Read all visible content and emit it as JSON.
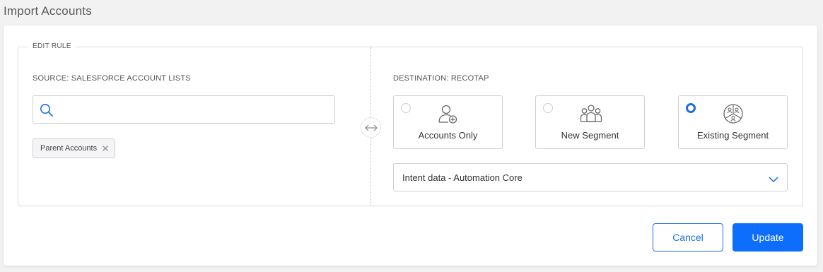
{
  "page": {
    "title": "Import Accounts"
  },
  "edit_rule": {
    "legend": "EDIT RULE",
    "source": {
      "label": "SOURCE: SALESFORCE ACCOUNT LISTS",
      "search": {
        "value": "",
        "placeholder": "",
        "icon": "search-icon"
      },
      "selected_chips": [
        {
          "label": "Parent Accounts"
        }
      ]
    },
    "swap_icon": "swap-arrows-icon",
    "destination": {
      "label": "DESTINATION: RECOTAP",
      "options": [
        {
          "label": "Accounts Only",
          "icon": "add-user-icon",
          "selected": false
        },
        {
          "label": "New Segment",
          "icon": "group-icon",
          "selected": false
        },
        {
          "label": "Existing Segment",
          "icon": "segment-icon",
          "selected": true
        }
      ],
      "segment_select": {
        "value": "Intent data - Automation Core"
      }
    }
  },
  "actions": {
    "cancel": "Cancel",
    "update": "Update"
  },
  "colors": {
    "accent": "#0d6efd",
    "border": "#cfcfcf",
    "background": "#f2f2f2"
  }
}
